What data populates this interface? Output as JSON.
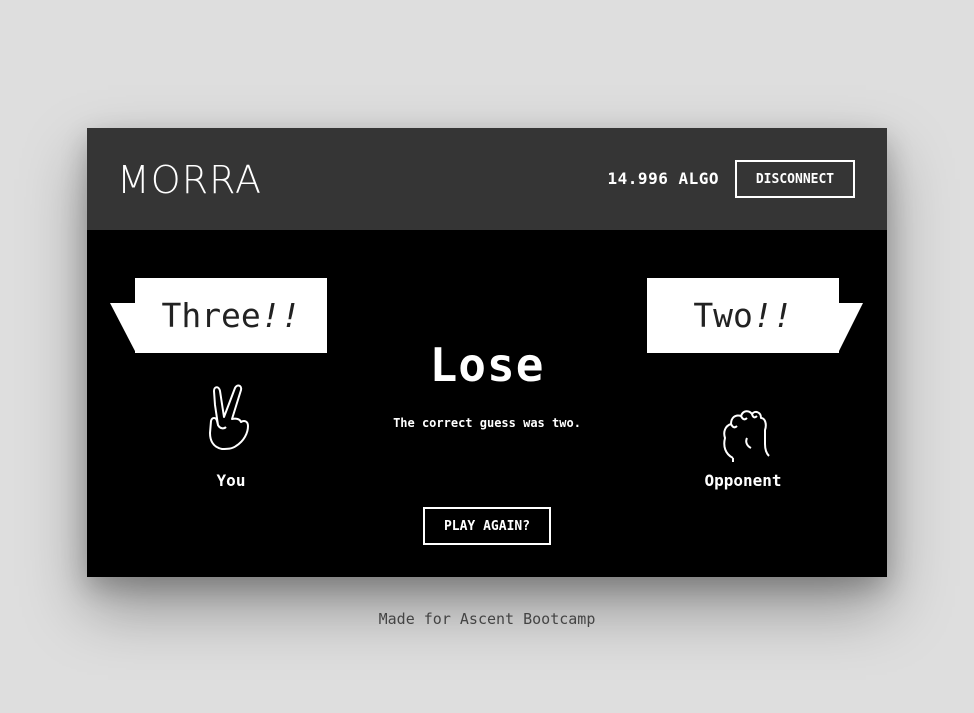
{
  "header": {
    "logo": "MORRA",
    "balance": "14.996 ALGO",
    "disconnect_label": "DISCONNECT"
  },
  "you": {
    "guess": "Three",
    "guess_suffix": "!!",
    "label": "You",
    "hand_icon": "two-fingers-hand-icon"
  },
  "opponent": {
    "guess": "Two",
    "guess_suffix": "!!",
    "label": "Opponent",
    "hand_icon": "fist-hand-icon"
  },
  "result": {
    "title": "Lose",
    "message_prefix": "The correct guess was ",
    "correct_guess": "two",
    "message_suffix": "."
  },
  "actions": {
    "play_again_label": "PLAY AGAIN?"
  },
  "footer": {
    "text": "Made for Ascent Bootcamp"
  }
}
